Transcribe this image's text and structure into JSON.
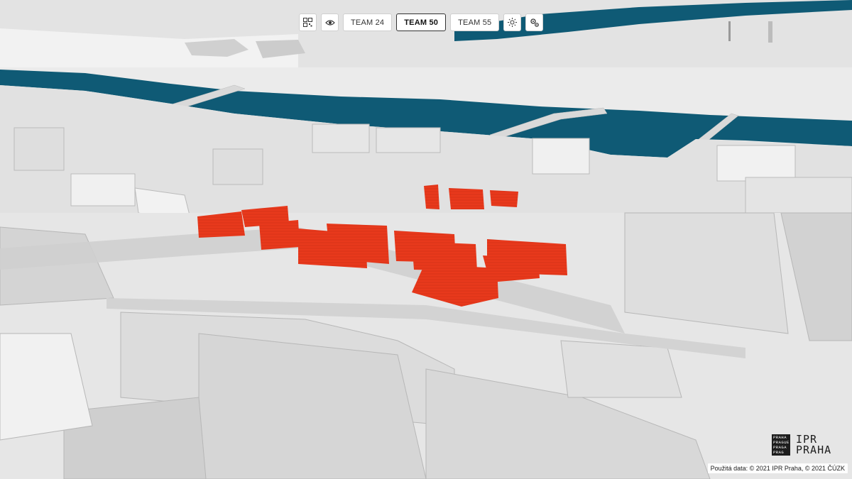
{
  "toolbar": {
    "buttons": [
      {
        "label": "TEAM 24",
        "active": false
      },
      {
        "label": "TEAM 50",
        "active": true
      },
      {
        "label": "TEAM 55",
        "active": false
      }
    ],
    "icons": [
      "qr-code-icon",
      "eye-icon",
      "sun-icon",
      "settings-icon"
    ]
  },
  "logo": {
    "mark_lines": [
      "PRAHA",
      "PRAGUE",
      "PRAGA",
      "PRAG"
    ],
    "text_line1": "IPR",
    "text_line2": "PRAHA"
  },
  "attribution": "Použitá data: © 2021 IPR Praha, © 2021 ČÚZK",
  "colors": {
    "river": "#0f5a75",
    "ground": "#e9e9e9",
    "building": "#d6d6d6",
    "proposal": "#e8391c"
  }
}
